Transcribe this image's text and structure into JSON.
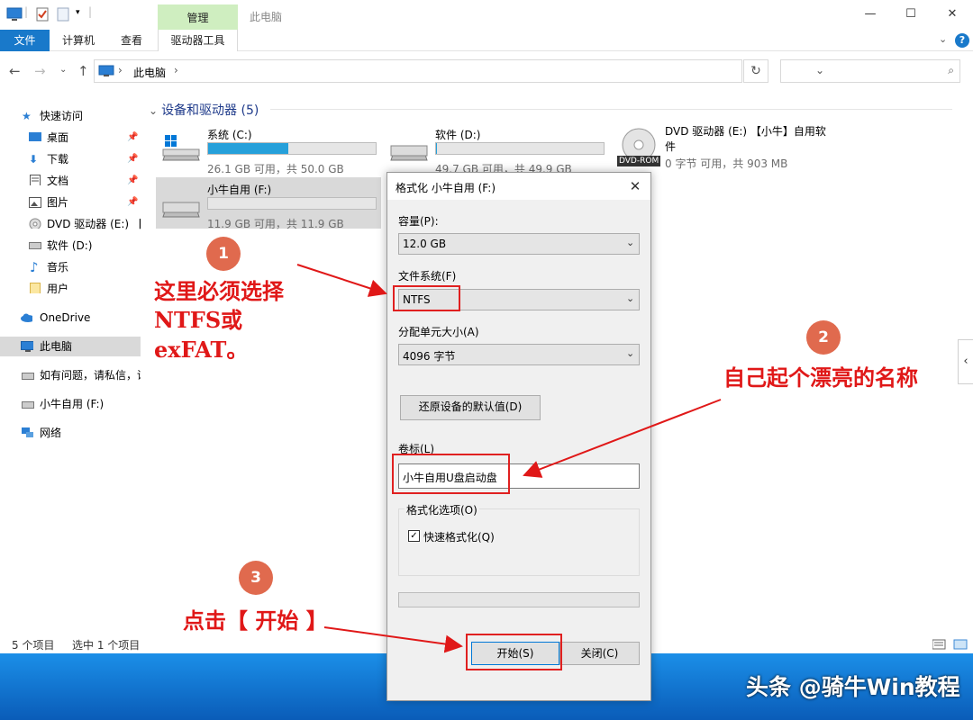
{
  "titlebar": {
    "context_tab_group": "管理",
    "window_title": "此电脑"
  },
  "ribbon": {
    "file_tab": "文件",
    "tabs": [
      "计算机",
      "查看",
      "驱动器工具"
    ]
  },
  "address": {
    "crumb": "此电脑",
    "search_placeholder": ""
  },
  "navpane": {
    "items": [
      {
        "label": "快速访问",
        "icon": "star-icon"
      },
      {
        "label": "桌面",
        "icon": "desktop-icon",
        "pinned": true
      },
      {
        "label": "下载",
        "icon": "download-icon",
        "pinned": true
      },
      {
        "label": "文档",
        "icon": "document-icon",
        "pinned": true
      },
      {
        "label": "图片",
        "icon": "picture-icon",
        "pinned": true
      },
      {
        "label": "DVD 驱动器 (E:) 【",
        "icon": "dvd-icon"
      },
      {
        "label": "软件 (D:)",
        "icon": "drive-icon"
      },
      {
        "label": "音乐",
        "icon": "music-icon"
      },
      {
        "label": "用户",
        "icon": "folder-icon"
      },
      {
        "label": "OneDrive",
        "icon": "cloud-icon"
      },
      {
        "label": "此电脑",
        "icon": "pc-icon",
        "selected": true
      },
      {
        "label": "如有问题，请私信，谁",
        "icon": "drive-icon"
      },
      {
        "label": "小牛自用 (F:)",
        "icon": "drive-icon"
      },
      {
        "label": "网络",
        "icon": "network-icon"
      }
    ]
  },
  "content": {
    "section_header": "设备和驱动器 (5)",
    "drives": [
      {
        "name": "系统 (C:)",
        "info": "26.1 GB 可用，共 50.0 GB",
        "used_fraction": 0.478
      },
      {
        "name": "软件 (D:)",
        "info": "49.7 GB 可用，共 49.9 GB",
        "used_fraction": 0.004
      },
      {
        "name": "DVD 驱动器 (E:) 【小牛】自用软件",
        "info": "0 字节 可用，共 903 MB",
        "badge": "DVD-ROM"
      },
      {
        "name": "小牛自用 (F:)",
        "info": "11.9 GB 可用，共 11.9 GB",
        "used_fraction": 0.0
      }
    ]
  },
  "statusbar": {
    "count": "5 个项目",
    "selected": "选中 1 个项目"
  },
  "dialog": {
    "title": "格式化 小牛自用 (F:)",
    "capacity_label": "容量(P):",
    "capacity_value": "12.0 GB",
    "fs_label": "文件系统(F)",
    "fs_value": "NTFS",
    "alloc_label": "分配单元大小(A)",
    "alloc_value": "4096 字节",
    "restore_button": "还原设备的默认值(D)",
    "volume_label": "卷标(L)",
    "volume_value": "小牛自用U盘启动盘",
    "options_label": "格式化选项(O)",
    "quick_format": "快速格式化(Q)",
    "quick_format_checked": true,
    "start_button": "开始(S)",
    "close_button": "关闭(C)"
  },
  "annotations": {
    "n1": "1",
    "n2": "2",
    "n3": "3",
    "text1_line1": "这里必须选择",
    "text1_line2": "NTFS或",
    "text1_line3": "exFAT。",
    "text2": "自己起个漂亮的名称",
    "text3": "点击【 开始 】"
  },
  "watermark": "头条 @骑牛Win教程",
  "colors": {
    "accent": "#1979ca",
    "annotation_red": "#e01818",
    "drive_bar": "#26a0da",
    "context_tab": "#cfeec0"
  }
}
